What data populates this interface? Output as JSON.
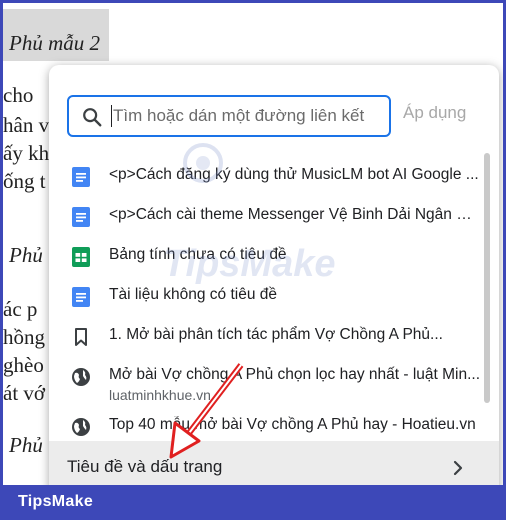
{
  "document": {
    "heading1": "Phủ mẫu 2",
    "heading2": "Phủ",
    "heading3": "Phủ",
    "fragments_block1": [
      "cho",
      "hân v",
      "ấy kh",
      "ống t"
    ],
    "fragments_block2": [
      "ác p",
      "hồng",
      "ghèo",
      "át vớ"
    ]
  },
  "search": {
    "placeholder": "Tìm hoặc dán một đường liên kết",
    "value": "",
    "apply_label": "Áp dụng"
  },
  "links": [
    {
      "title": "<p>Cách đăng ký dùng thử MusicLM bot AI Google ...",
      "icon": "google-docs-icon",
      "color": "#4285f4"
    },
    {
      "title": "<p>Cách cài theme Messenger Vệ Binh Dải Ngân Hà...",
      "icon": "google-docs-icon",
      "color": "#4285f4"
    },
    {
      "title": "Bảng tính chưa có tiêu đề",
      "icon": "google-sheets-icon",
      "color": "#0f9d58"
    },
    {
      "title": "Tài liệu không có tiêu đề",
      "icon": "google-docs-icon",
      "color": "#4285f4"
    },
    {
      "title": "1. Mở bài phân tích tác phẩm Vợ Chồng A Phủ...",
      "icon": "bookmark-icon",
      "color": "#3c4043"
    },
    {
      "title": "Mở bài Vợ chồng A Phủ chọn lọc hay nhất - luật Min...",
      "subtitle": "luatminhkhue.vn",
      "icon": "globe-icon",
      "color": "#3c4043"
    },
    {
      "title": "Top 40 mẫu mở bài Vợ chồng A Phủ hay - Hoatieu.vn",
      "icon": "globe-icon",
      "color": "#3c4043"
    }
  ],
  "footer": {
    "label": "Tiêu đề và dấu trang",
    "icon": "chevron-right-icon"
  },
  "branding": {
    "text": "TipsMake",
    "watermark": "TipsMake",
    "bar_color": "#3d48b8"
  },
  "colors": {
    "accent": "#1a73e8",
    "annotation": "#e02020"
  }
}
